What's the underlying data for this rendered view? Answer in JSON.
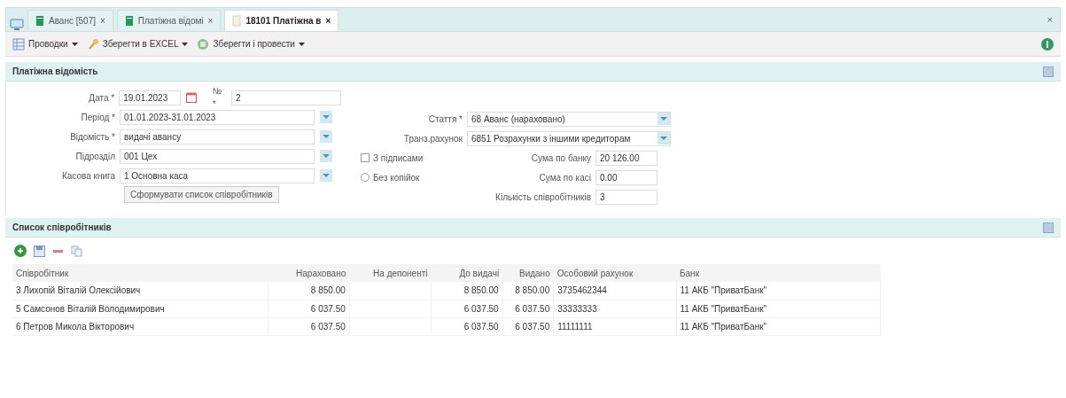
{
  "tabs": [
    {
      "label": "Аванс [507]",
      "selected": false,
      "close": "×"
    },
    {
      "label": "Платіжна відомі",
      "selected": false,
      "close": "×"
    },
    {
      "label": "18101 Платіжна в",
      "selected": true,
      "close": "×"
    }
  ],
  "close_all": "×",
  "toolbar": [
    {
      "label": "Проводки"
    },
    {
      "label": "Зберегти в EXCEL"
    },
    {
      "label": "Зберегти і провести"
    }
  ],
  "form": {
    "title": "Платіжна відомість",
    "date": {
      "label": "Дата *",
      "value": "19.01.2023"
    },
    "number": {
      "label": "№ *",
      "value": "2"
    },
    "left_fields": [
      {
        "label": "Період *",
        "value": "01.01.2023-31.01.2023"
      },
      {
        "label": "Відомість *",
        "value": "видачі авансу"
      },
      {
        "label": "Підрозділ",
        "value": "001 Цех"
      },
      {
        "label": "Касова книга",
        "value": "1 Основна каса"
      }
    ],
    "generate_button": "Сформувати список співробітників",
    "right_fields": [
      {
        "label": "Стаття *",
        "value": "68 Аванс (нараховано)"
      },
      {
        "label": "Транз.рахунок",
        "value": "6851 Розрахунки з іншими кредиторам"
      }
    ],
    "options": [
      {
        "label": "З підписами",
        "checked": false,
        "kind": "checkbox"
      },
      {
        "label": "Без копійок",
        "checked": false,
        "kind": "radio"
      }
    ],
    "totals": [
      {
        "label": "Сума по банку",
        "value": "20 126.00"
      },
      {
        "label": "Сума по касі",
        "value": "0.00"
      },
      {
        "label": "Кількість співробітників",
        "value": "3"
      }
    ]
  },
  "employees": {
    "title": "Список співробітників",
    "columns": [
      "Співробітник",
      "Нараховано",
      "На депоненті",
      "До видачі",
      "Видано",
      "Особовий рахунок",
      "Банк"
    ],
    "rows": [
      [
        "3 Лихопій Віталій Олексійович",
        "8 850.00",
        "",
        "8 850.00",
        "8 850.00",
        "3735462344",
        "11 АКБ \"ПриватБанк\""
      ],
      [
        "5 Самсонов Віталій Володимирович",
        "6 037.50",
        "",
        "6 037.50",
        "6 037.50",
        "33333333",
        "11 АКБ \"ПриватБанк\""
      ],
      [
        "6 Петров Микола Вікторович",
        "6 037.50",
        "",
        "6 037.50",
        "6 037.50",
        "11111111",
        "11 АКБ \"ПриватБанк\""
      ]
    ]
  }
}
